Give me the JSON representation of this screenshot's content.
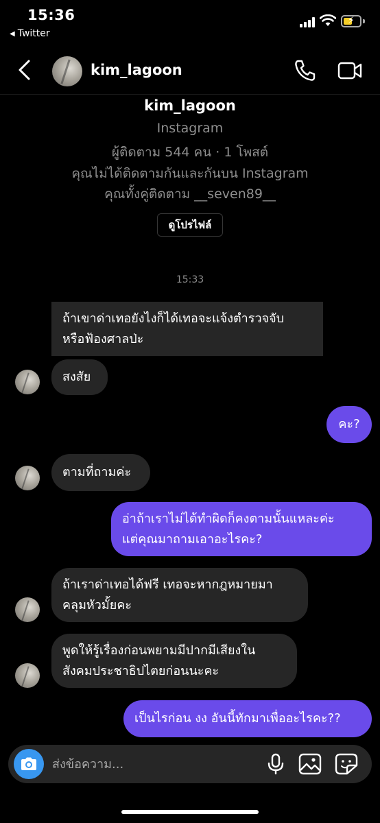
{
  "status_bar": {
    "time": "15:36",
    "back_app": "Twitter",
    "battery_color": "#f4cd28"
  },
  "header": {
    "username": "kim_lagoon",
    "icons": [
      "back-chevron-icon",
      "phone-icon",
      "video-camera-icon"
    ]
  },
  "profile": {
    "name": "kim_lagoon",
    "platform": "Instagram",
    "stats": "ผู้ติดตาม 544 คน · 1 โพสต์",
    "follow_note": "คุณไม่ได้ติดตามกันและกันบน Instagram",
    "mutual": "คุณทั้งคู่ติดตาม __seven89__",
    "view_profile_label": "ดูโปรไฟล์"
  },
  "timestamp": "15:33",
  "messages": [
    {
      "side": "in",
      "lines": [
        "ถ้าเขาด่าเทอยังไงก็ได้เทอจะแจ้งตำรวจจับ",
        "หรือฟ้องศาลป่ะ"
      ]
    },
    {
      "side": "in",
      "lines": [
        "สงสัย"
      ]
    },
    {
      "side": "out",
      "lines": [
        "คะ?"
      ]
    },
    {
      "side": "in",
      "lines": [
        "ตามที่ถามค่ะ"
      ]
    },
    {
      "side": "out",
      "lines": [
        "อ่าถ้าเราไม่ได้ทำผิดก็คงตามนั้นแหละค่ะ",
        "แต่คุณมาถามเอาอะไรคะ?"
      ]
    },
    {
      "side": "in",
      "lines": [
        "ถ้าเราด่าเทอได้ฟรี เทอจะหากฎหมายมา",
        "คลุมหัวมั้ยคะ"
      ]
    },
    {
      "side": "in",
      "lines": [
        "พูดให้รู้เรื่องก่อนพยามมีปากมีเสียงใน",
        "สังคมประชาธิปไตยก่อนนะคะ"
      ]
    },
    {
      "side": "out",
      "lines": [
        "เป็นไรก่อน งง อันนี้ทักมาเพื่ออะไรคะ??"
      ]
    }
  ],
  "composer": {
    "placeholder": "ส่งข้อความ...",
    "icons": [
      "camera-icon",
      "microphone-icon",
      "gallery-icon",
      "sticker-icon"
    ],
    "camera_color": "#3897f0"
  },
  "colors": {
    "background": "#000000",
    "incoming_bubble": "#262626",
    "outgoing_bubble": "#6a4bea",
    "secondary_text": "#8e8e8e"
  }
}
